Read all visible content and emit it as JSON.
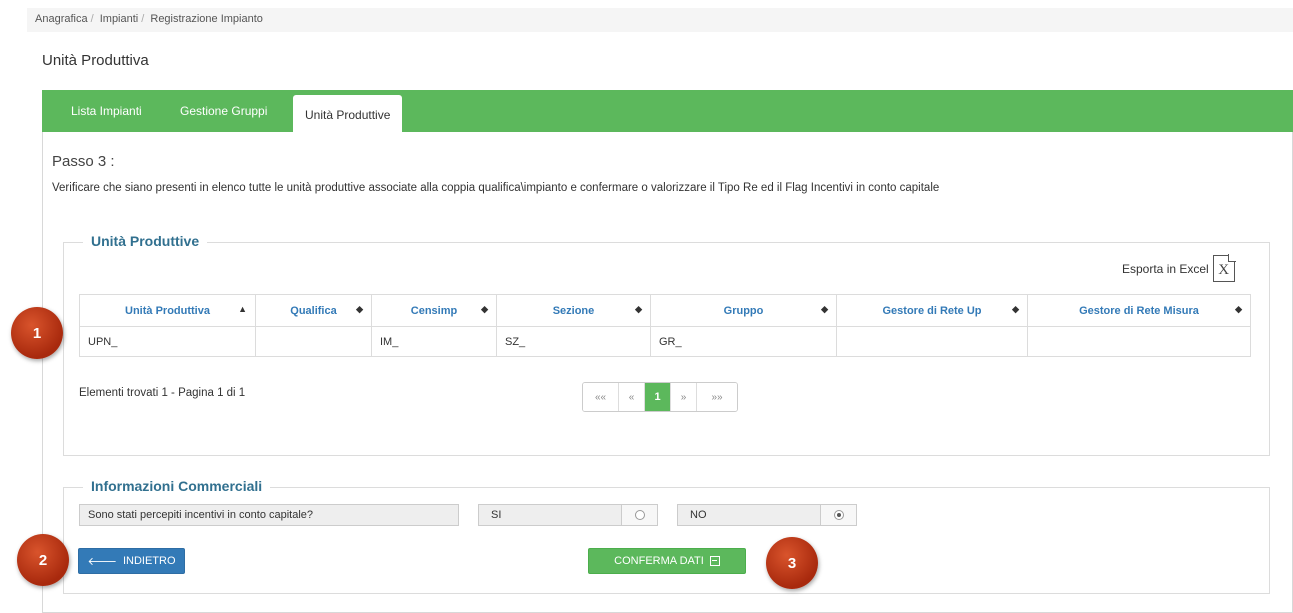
{
  "breadcrumb": {
    "items": [
      "Anagrafica",
      "Impianti",
      "Registrazione Impianto"
    ],
    "separator": "/"
  },
  "page_title": "Unità Produttiva",
  "tabs": [
    {
      "label": "Lista Impianti",
      "active": false
    },
    {
      "label": "Gestione Gruppi",
      "active": false
    },
    {
      "label": "Unità Produttive",
      "active": true
    }
  ],
  "step": {
    "title": "Passo 3 :",
    "description": "Verificare che siano presenti in elenco tutte le unità produttive associate alla coppia qualifica\\impianto e confermare o valorizzare il Tipo Re ed il Flag Incentivi in conto capitale"
  },
  "units_section": {
    "legend": "Unità Produttive",
    "export_label": "Esporta in Excel",
    "export_icon_glyph": "X",
    "columns": [
      "Unità Produttiva",
      "Qualifica",
      "Censimp",
      "Sezione",
      "Gruppo",
      "Gestore di Rete Up",
      "Gestore di Rete Misura"
    ],
    "sort_icons": [
      "▲",
      "◆",
      "◆",
      "◆",
      "◆",
      "◆",
      "◆"
    ],
    "rows": [
      [
        "UPN_",
        "",
        "IM_",
        "SZ_",
        "GR_",
        "",
        ""
      ]
    ],
    "found_text": "Elementi trovati 1 - Pagina 1 di 1",
    "pagination": [
      "««",
      "«",
      "1",
      "»",
      "»»"
    ],
    "current_page": 1
  },
  "commercial": {
    "legend": "Informazioni Commerciali",
    "question": "Sono stati percepiti incentivi in conto capitale?",
    "options": [
      {
        "label": "SI",
        "checked": false
      },
      {
        "label": "NO",
        "checked": true
      }
    ]
  },
  "buttons": {
    "back_arrow": "🡐",
    "back_label": "INDIETRO",
    "confirm_label": "CONFERMA DATI"
  },
  "callouts": [
    "1",
    "2",
    "3"
  ],
  "colors": {
    "tabbar": "#5cb85c",
    "link_blue": "#337ab7",
    "legend_blue": "#31708f",
    "badge_red": "#c23a17"
  }
}
